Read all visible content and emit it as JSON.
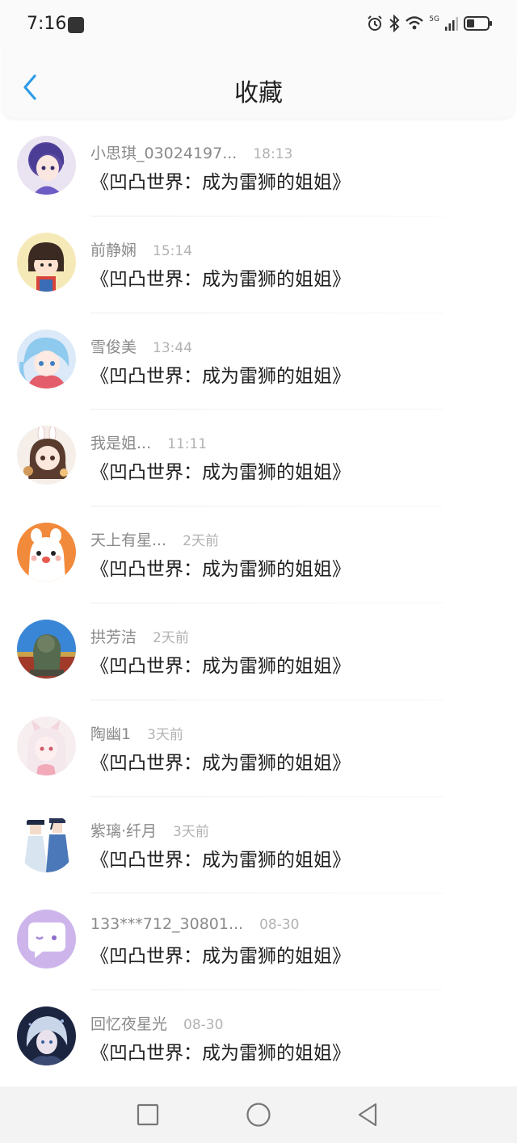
{
  "status_bar": {
    "time": "7:16",
    "network": "5G",
    "icons": [
      "notification-icon",
      "alarm-icon",
      "bluetooth-icon",
      "wifi-icon",
      "signal-icon",
      "battery-icon"
    ]
  },
  "header": {
    "title": "收藏",
    "back_icon": "chevron-left-icon",
    "accent_color": "#2f9be8"
  },
  "favorites": [
    {
      "user": "小思琪_03024197...",
      "time": "18:13",
      "book": "《凹凸世界：成为雷狮的姐姐》"
    },
    {
      "user": "前静娴",
      "time": "15:14",
      "book": "《凹凸世界：成为雷狮的姐姐》"
    },
    {
      "user": "雪俊美",
      "time": "13:44",
      "book": "《凹凸世界：成为雷狮的姐姐》"
    },
    {
      "user": "我是姐...",
      "time": "11:11",
      "book": "《凹凸世界：成为雷狮的姐姐》"
    },
    {
      "user": "天上有星...",
      "time": "2天前",
      "book": "《凹凸世界：成为雷狮的姐姐》"
    },
    {
      "user": "拱芳洁",
      "time": "2天前",
      "book": "《凹凸世界：成为雷狮的姐姐》"
    },
    {
      "user": "陶幽1",
      "time": "3天前",
      "book": "《凹凸世界：成为雷狮的姐姐》"
    },
    {
      "user": "紫璃·纤月",
      "time": "3天前",
      "book": "《凹凸世界：成为雷狮的姐姐》"
    },
    {
      "user": "133***712_30801...",
      "time": "08-30",
      "book": "《凹凸世界：成为雷狮的姐姐》"
    },
    {
      "user": "回忆夜星光",
      "time": "08-30",
      "book": "《凹凸世界：成为雷狮的姐姐》"
    }
  ],
  "nav_bar": {
    "buttons": [
      "recent-apps-square-icon",
      "home-circle-icon",
      "back-triangle-icon"
    ]
  }
}
